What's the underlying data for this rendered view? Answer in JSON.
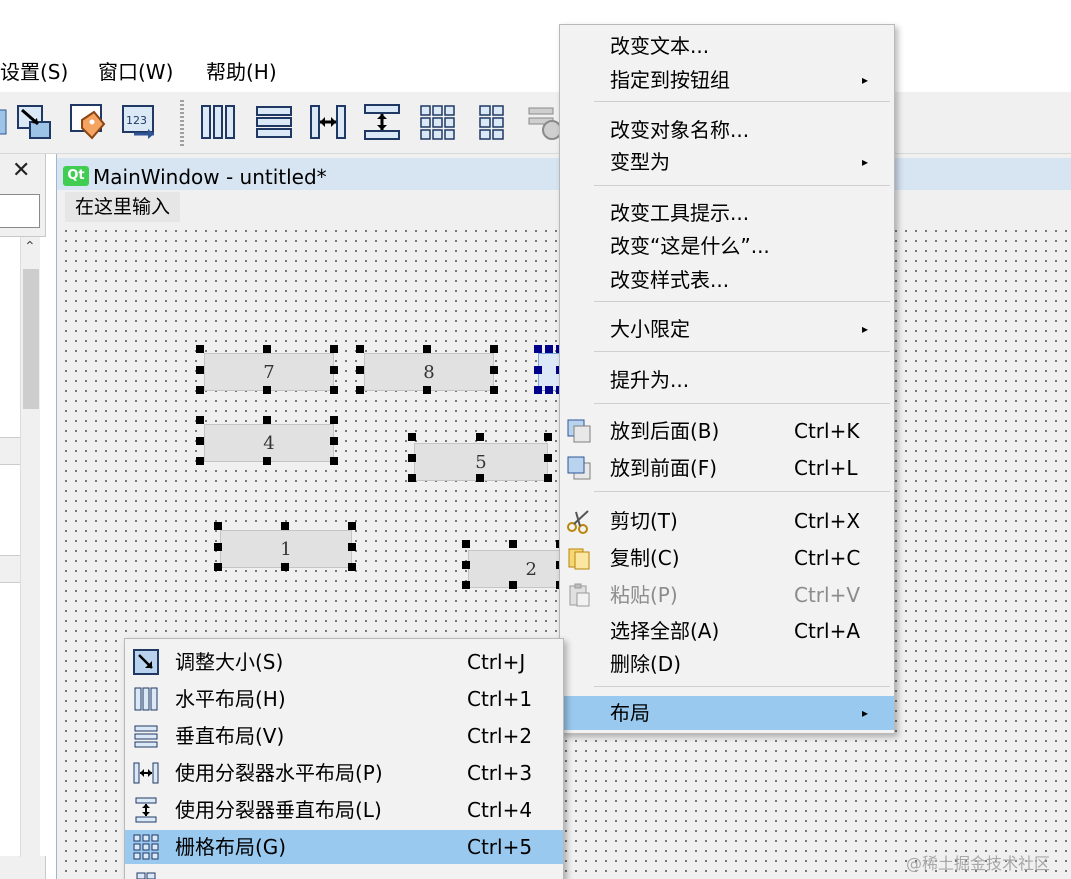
{
  "menubar": {
    "settings": "设置(S)",
    "window": "窗口(W)",
    "help": "帮助(H)"
  },
  "left_dock": {
    "close_glyph": "✕",
    "scroll_up_glyph": "⌃"
  },
  "main_window": {
    "logo": "Qt",
    "title": "MainWindow - untitled*",
    "menu_placeholder": "在这里输入"
  },
  "widgets": {
    "btn7": "7",
    "btn8": "8",
    "btn4": "4",
    "btn5": "5",
    "btn1": "1",
    "btn2": "2"
  },
  "context_menu": {
    "change_text": "改变文本...",
    "assign_button_group": "指定到按钮组",
    "change_object_name": "改变对象名称...",
    "morph_into": "变型为",
    "change_tooltip": "改变工具提示...",
    "change_whats_this": "改变“这是什么”...",
    "change_stylesheet": "改变样式表...",
    "size_constraints": "大小限定",
    "promote_to": "提升为...",
    "send_to_back": "放到后面(B)",
    "send_to_back_sc": "Ctrl+K",
    "bring_to_front": "放到前面(F)",
    "bring_to_front_sc": "Ctrl+L",
    "cut": "剪切(T)",
    "cut_sc": "Ctrl+X",
    "copy": "复制(C)",
    "copy_sc": "Ctrl+C",
    "paste": "粘贴(P)",
    "paste_sc": "Ctrl+V",
    "select_all": "选择全部(A)",
    "select_all_sc": "Ctrl+A",
    "delete": "删除(D)",
    "layout": "布局",
    "submenu_arrow": "▸"
  },
  "layout_submenu": {
    "adjust_size": "调整大小(S)",
    "adjust_size_sc": "Ctrl+J",
    "horizontal": "水平布局(H)",
    "horizontal_sc": "Ctrl+1",
    "vertical": "垂直布局(V)",
    "vertical_sc": "Ctrl+2",
    "splitter_h": "使用分裂器水平布局(P)",
    "splitter_h_sc": "Ctrl+3",
    "splitter_v": "使用分裂器垂直布局(L)",
    "splitter_v_sc": "Ctrl+4",
    "grid": "栅格布局(G)",
    "grid_sc": "Ctrl+5"
  },
  "watermark": "@稀土掘金技术社区",
  "colors": {
    "highlight": "#99c9ef",
    "menu_bg": "#f2f2f2",
    "canvas_bg": "#f0f0f0",
    "title_bar": "#d7e4f2",
    "qt_green": "#41cd52"
  }
}
